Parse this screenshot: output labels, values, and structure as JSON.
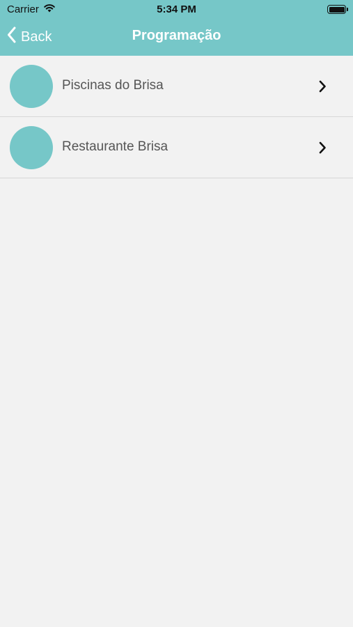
{
  "status_bar": {
    "carrier": "Carrier",
    "time": "5:34 PM"
  },
  "nav": {
    "back_label": "Back",
    "title": "Programação"
  },
  "list": {
    "items": [
      {
        "label": "Piscinas do Brisa",
        "icon": "chevron-right-icon"
      },
      {
        "label": "Restaurante Brisa",
        "icon": "chevron-right-icon"
      }
    ]
  },
  "colors": {
    "accent": "#76c7c8",
    "background": "#f2f2f2",
    "text": "#555555"
  }
}
